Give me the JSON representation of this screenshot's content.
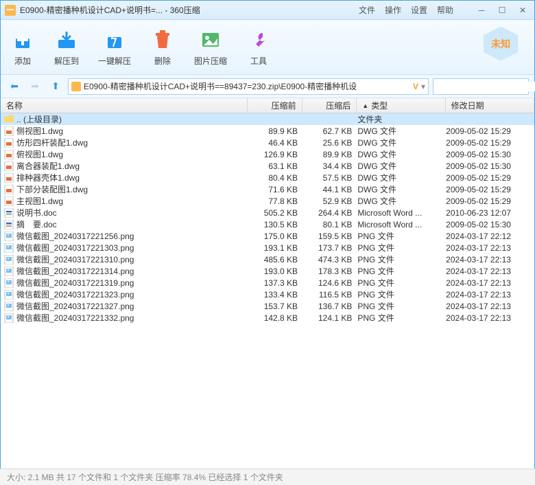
{
  "window": {
    "title": "E0900-精密播种机设计CAD+说明书=... - 360压缩",
    "menu": [
      "文件",
      "操作",
      "设置",
      "帮助"
    ],
    "badge": "未知"
  },
  "toolbar": {
    "items": [
      {
        "label": "添加",
        "icon": "add",
        "color": "#2196f3",
        "bg": "#2196f3"
      },
      {
        "label": "解压到",
        "icon": "extract",
        "color": "#2196f3",
        "bg": "#2196f3"
      },
      {
        "label": "一键解压",
        "icon": "oneclick",
        "color": "#2196f3",
        "bg": "#2196f3"
      },
      {
        "label": "删除",
        "icon": "delete",
        "color": "#f36a3e",
        "bg": "#f36a3e"
      },
      {
        "label": "图片压缩",
        "icon": "image",
        "color": "#4fb86a",
        "bg": "#4fb86a"
      },
      {
        "label": "工具",
        "icon": "tool",
        "color": "#b84fcf",
        "bg": "#b84fcf"
      }
    ]
  },
  "path": {
    "text": "E0900-精密播种机设计CAD+说明书==89437=230.zip\\E0900-精密播种机设",
    "search_placeholder": ""
  },
  "columns": {
    "name": "名称",
    "before": "压缩前",
    "after": "压缩后",
    "type": "类型",
    "date": "修改日期"
  },
  "upDir": ".. (上级目录)",
  "upType": "文件夹",
  "files": [
    {
      "name": "侧视图1.dwg",
      "before": "89.9 KB",
      "after": "62.7 KB",
      "type": "DWG 文件",
      "date": "2009-05-02 15:29",
      "icon": "dwg"
    },
    {
      "name": "仿形四杆装配1.dwg",
      "before": "46.4 KB",
      "after": "25.6 KB",
      "type": "DWG 文件",
      "date": "2009-05-02 15:29",
      "icon": "dwg"
    },
    {
      "name": "俯视图1.dwg",
      "before": "126.9 KB",
      "after": "89.9 KB",
      "type": "DWG 文件",
      "date": "2009-05-02 15:30",
      "icon": "dwg"
    },
    {
      "name": "离合器装配1.dwg",
      "before": "63.1 KB",
      "after": "34.4 KB",
      "type": "DWG 文件",
      "date": "2009-05-02 15:30",
      "icon": "dwg"
    },
    {
      "name": "排种器壳体1.dwg",
      "before": "80.4 KB",
      "after": "57.5 KB",
      "type": "DWG 文件",
      "date": "2009-05-02 15:29",
      "icon": "dwg"
    },
    {
      "name": "下部分装配图1.dwg",
      "before": "71.6 KB",
      "after": "44.1 KB",
      "type": "DWG 文件",
      "date": "2009-05-02 15:29",
      "icon": "dwg"
    },
    {
      "name": "主视图1.dwg",
      "before": "77.8 KB",
      "after": "52.9 KB",
      "type": "DWG 文件",
      "date": "2009-05-02 15:29",
      "icon": "dwg"
    },
    {
      "name": "说明书.doc",
      "before": "505.2 KB",
      "after": "264.4 KB",
      "type": "Microsoft Word ...",
      "date": "2010-06-23 12:07",
      "icon": "doc"
    },
    {
      "name": "摘　要.doc",
      "before": "130.5 KB",
      "after": "80.1 KB",
      "type": "Microsoft Word ...",
      "date": "2009-05-02 15:30",
      "icon": "doc"
    },
    {
      "name": "微信截图_20240317221256.png",
      "before": "175.0 KB",
      "after": "159.5 KB",
      "type": "PNG 文件",
      "date": "2024-03-17 22:12",
      "icon": "png"
    },
    {
      "name": "微信截图_20240317221303.png",
      "before": "193.1 KB",
      "after": "173.7 KB",
      "type": "PNG 文件",
      "date": "2024-03-17 22:13",
      "icon": "png"
    },
    {
      "name": "微信截图_20240317221310.png",
      "before": "485.6 KB",
      "after": "474.3 KB",
      "type": "PNG 文件",
      "date": "2024-03-17 22:13",
      "icon": "png"
    },
    {
      "name": "微信截图_20240317221314.png",
      "before": "193.0 KB",
      "after": "178.3 KB",
      "type": "PNG 文件",
      "date": "2024-03-17 22:13",
      "icon": "png"
    },
    {
      "name": "微信截图_20240317221319.png",
      "before": "137.3 KB",
      "after": "124.6 KB",
      "type": "PNG 文件",
      "date": "2024-03-17 22:13",
      "icon": "png"
    },
    {
      "name": "微信截图_20240317221323.png",
      "before": "133.4 KB",
      "after": "116.5 KB",
      "type": "PNG 文件",
      "date": "2024-03-17 22:13",
      "icon": "png"
    },
    {
      "name": "微信截图_20240317221327.png",
      "before": "153.7 KB",
      "after": "136.7 KB",
      "type": "PNG 文件",
      "date": "2024-03-17 22:13",
      "icon": "png"
    },
    {
      "name": "微信截图_20240317221332.png",
      "before": "142.8 KB",
      "after": "124.1 KB",
      "type": "PNG 文件",
      "date": "2024-03-17 22:13",
      "icon": "png"
    }
  ],
  "status": "大小: 2.1 MB 共 17 个文件和 1 个文件夹 压缩率 78.4%  已经选择 1 个文件夹"
}
